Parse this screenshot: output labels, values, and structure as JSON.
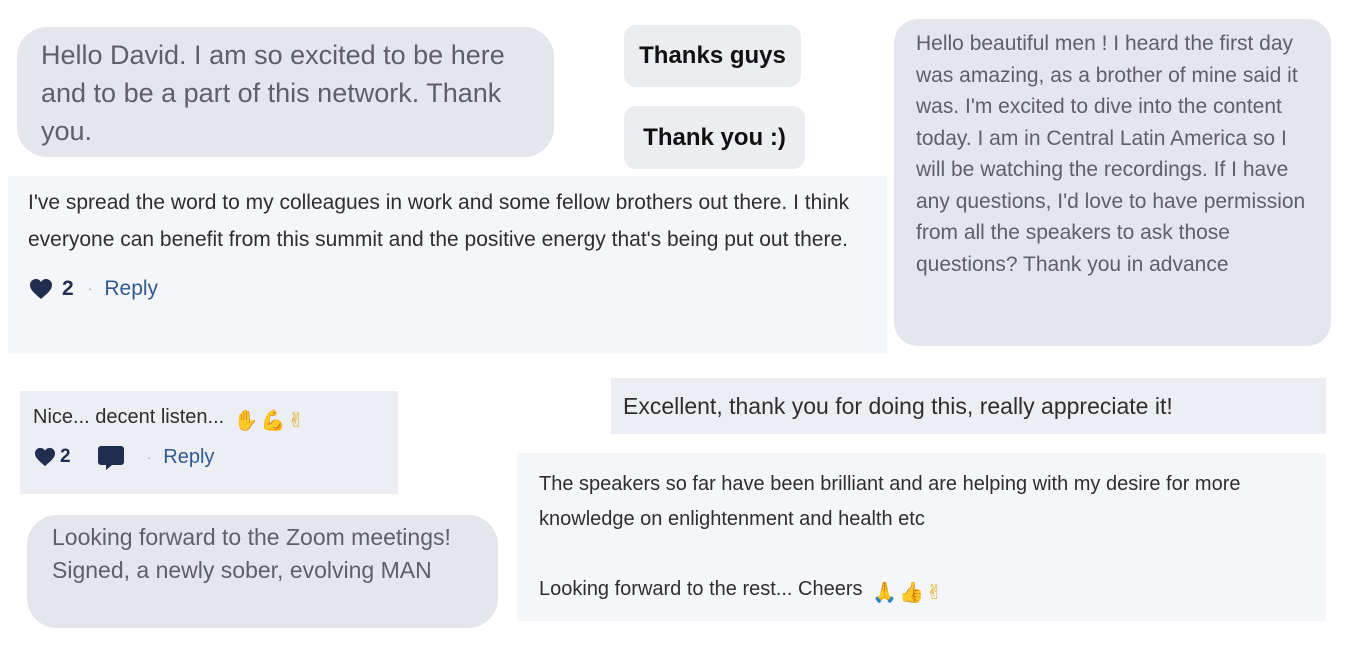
{
  "comments": {
    "c1": {
      "text": "Hello David. I am so excited to be here and to be a part of this network. Thank you."
    },
    "c2": {
      "text": "Thanks guys"
    },
    "c3": {
      "text": "Thank you :)"
    },
    "c4": {
      "text": "Hello beautiful men ! I heard the first day was amazing, as a brother of mine said it was. I'm excited to dive into the content today. I am in Central Latin America so I will be watching the recordings. If I have any questions, I'd love to have permission from all the speakers to ask those questions? Thank you in advance"
    },
    "c5": {
      "text": "I've spread the word to my colleagues in work and some fellow brothers out there.  I think everyone can benefit from this summit and the positive energy that's being put out there.",
      "likes": "2",
      "separator": "·",
      "reply_label": "Reply"
    },
    "c6": {
      "text": "Nice... decent listen...",
      "emojis": [
        "raising-hands",
        "flexed-biceps",
        "victory-hand"
      ],
      "likes": "2",
      "separator": "·",
      "reply_label": "Reply"
    },
    "c7": {
      "text": "Excellent, thank you for doing this, really appreciate it!"
    },
    "c8": {
      "paragraph1": "The speakers so far have been brilliant and are helping with my desire for more knowledge on enlightenment and health etc",
      "paragraph2": "Looking forward to the rest... Cheers",
      "emojis": [
        "folded-hands",
        "thumbs-up",
        "victory-hand"
      ]
    },
    "c9": {
      "text": "Looking forward to the Zoom meetings! Signed, a newly sober, evolving MAN"
    }
  },
  "colors": {
    "bubble_bg": "#e4e6eb",
    "flat_bg": "#f5f6fa",
    "like_heart": "#1f2d4e",
    "reply_link": "#2f5a8f"
  }
}
